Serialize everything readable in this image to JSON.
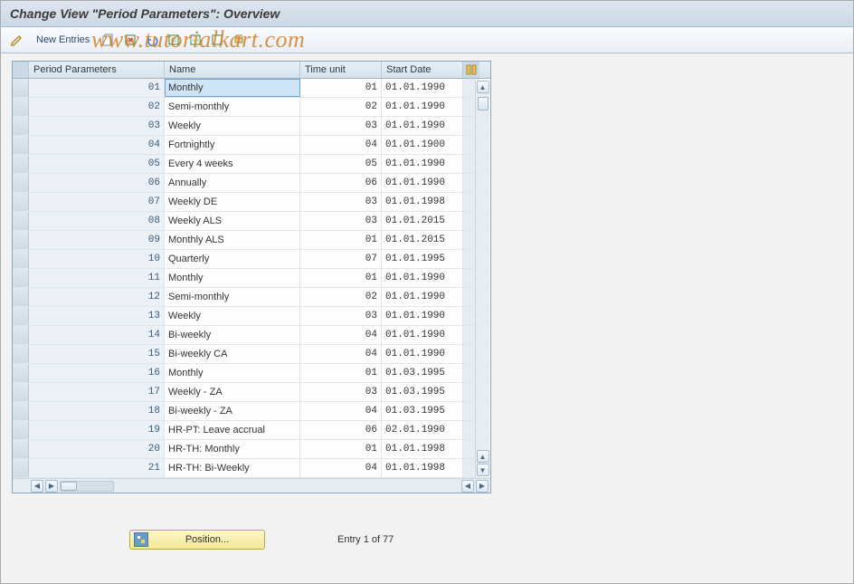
{
  "title": "Change View \"Period Parameters\": Overview",
  "watermark": "www.tutorialkart.com",
  "toolbar": {
    "new_entries_label": "New Entries"
  },
  "table": {
    "headers": {
      "period_parameters": "Period Parameters",
      "name": "Name",
      "time_unit": "Time unit",
      "start_date": "Start Date"
    },
    "rows": [
      {
        "pp": "01",
        "name": "Monthly",
        "tu": "01",
        "sd": "01.01.1990"
      },
      {
        "pp": "02",
        "name": "Semi-monthly",
        "tu": "02",
        "sd": "01.01.1990"
      },
      {
        "pp": "03",
        "name": "Weekly",
        "tu": "03",
        "sd": "01.01.1990"
      },
      {
        "pp": "04",
        "name": "Fortnightly",
        "tu": "04",
        "sd": "01.01.1900"
      },
      {
        "pp": "05",
        "name": "Every 4 weeks",
        "tu": "05",
        "sd": "01.01.1990"
      },
      {
        "pp": "06",
        "name": "Annually",
        "tu": "06",
        "sd": "01.01.1990"
      },
      {
        "pp": "07",
        "name": "Weekly  DE",
        "tu": "03",
        "sd": "01.01.1998"
      },
      {
        "pp": "08",
        "name": "Weekly ALS",
        "tu": "03",
        "sd": "01.01.2015"
      },
      {
        "pp": "09",
        "name": "Monthly ALS",
        "tu": "01",
        "sd": "01.01.2015"
      },
      {
        "pp": "10",
        "name": "Quarterly",
        "tu": "07",
        "sd": "01.01.1995"
      },
      {
        "pp": "11",
        "name": "Monthly",
        "tu": "01",
        "sd": "01.01.1990"
      },
      {
        "pp": "12",
        "name": "Semi-monthly",
        "tu": "02",
        "sd": "01.01.1990"
      },
      {
        "pp": "13",
        "name": "Weekly",
        "tu": "03",
        "sd": "01.01.1990"
      },
      {
        "pp": "14",
        "name": "Bi-weekly",
        "tu": "04",
        "sd": "01.01.1990"
      },
      {
        "pp": "15",
        "name": "Bi-weekly CA",
        "tu": "04",
        "sd": "01.01.1990"
      },
      {
        "pp": "16",
        "name": "Monthly",
        "tu": "01",
        "sd": "01.03.1995"
      },
      {
        "pp": "17",
        "name": "Weekly - ZA",
        "tu": "03",
        "sd": "01.03.1995"
      },
      {
        "pp": "18",
        "name": "Bi-weekly - ZA",
        "tu": "04",
        "sd": "01.03.1995"
      },
      {
        "pp": "19",
        "name": "HR-PT: Leave accrual",
        "tu": "06",
        "sd": "02.01.1990"
      },
      {
        "pp": "20",
        "name": "HR-TH: Monthly",
        "tu": "01",
        "sd": "01.01.1998"
      },
      {
        "pp": "21",
        "name": "HR-TH: Bi-Weekly",
        "tu": "04",
        "sd": "01.01.1998"
      }
    ]
  },
  "footer": {
    "position_label": "Position...",
    "entry_text": "Entry 1 of 77"
  }
}
